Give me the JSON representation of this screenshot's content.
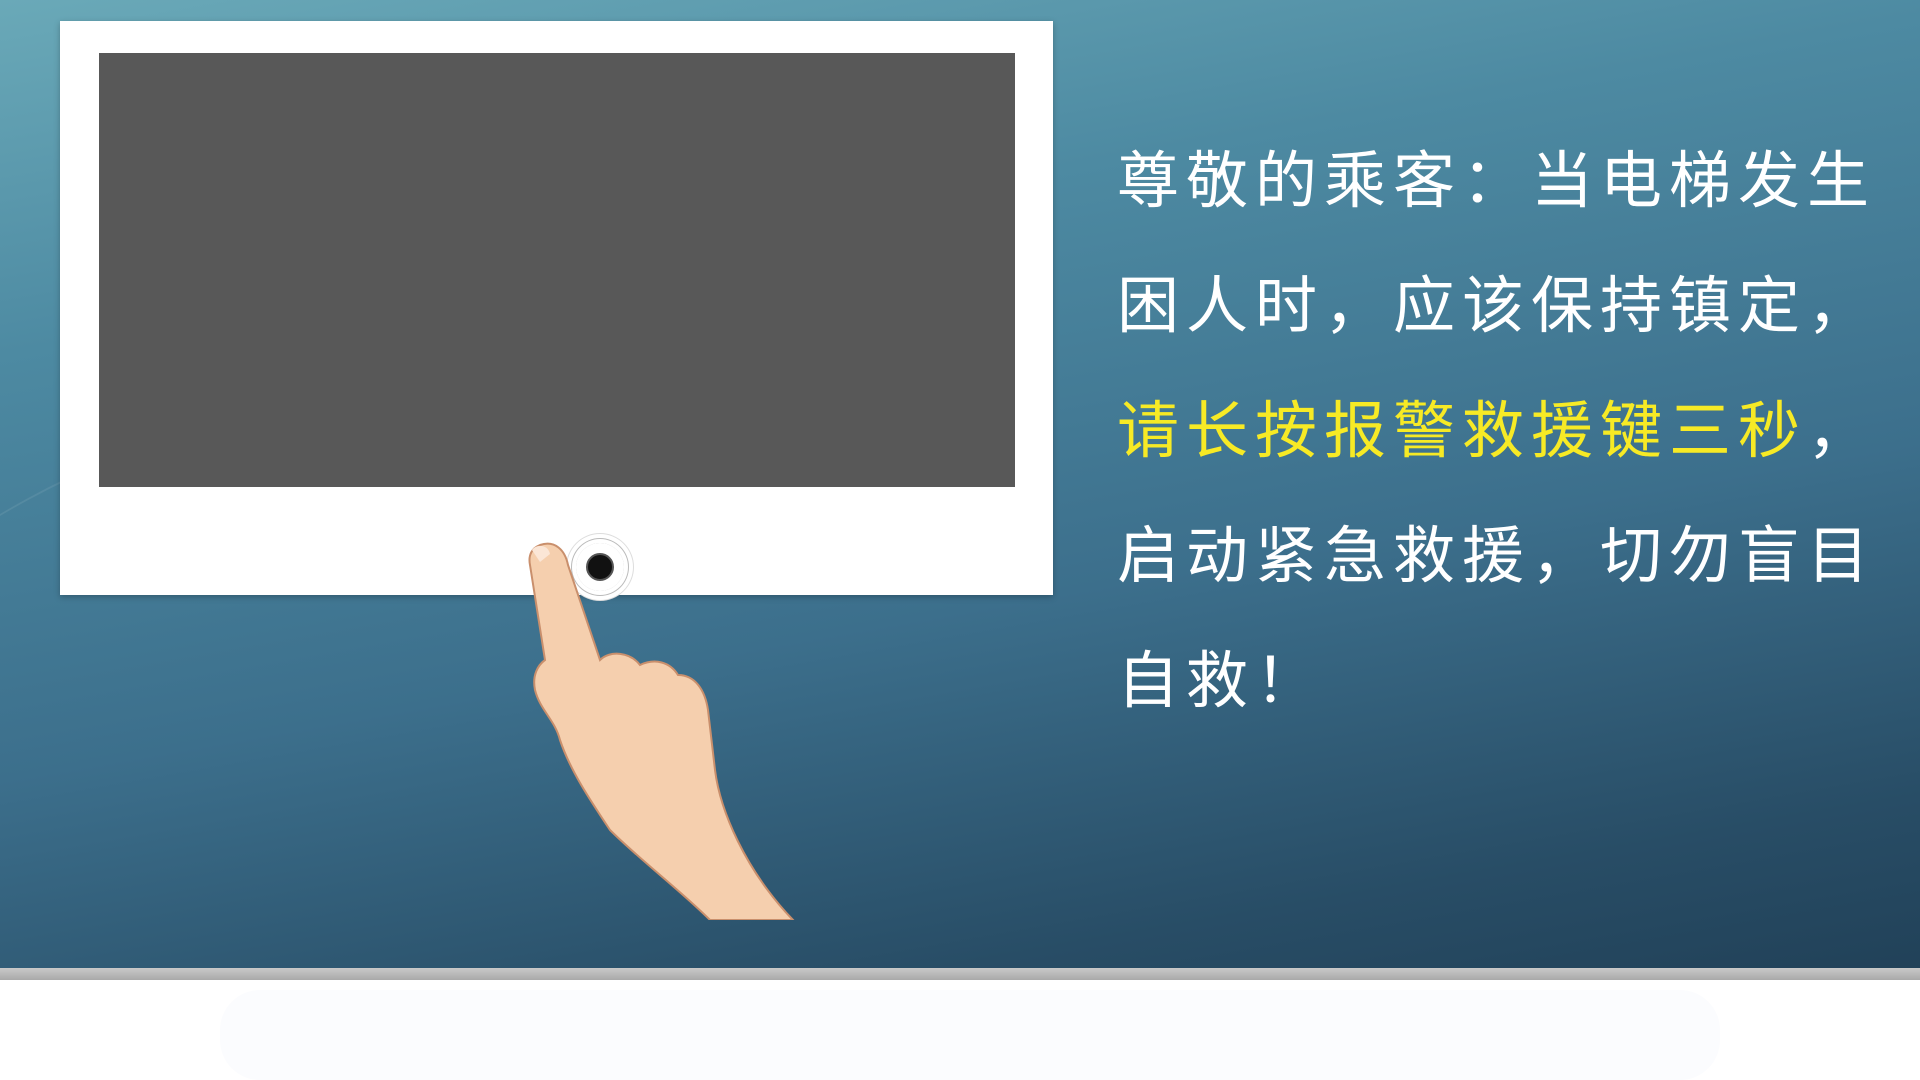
{
  "message": {
    "part1": "尊敬的乘客：当电梯发生困人时，应该保持镇定，",
    "highlight": "请长按报警救援键三秒",
    "part2": "，启动紧急救援，切勿盲目自救！"
  },
  "colors": {
    "highlight": "#f7ea25",
    "text": "#ffffff",
    "screen": "#585858"
  }
}
